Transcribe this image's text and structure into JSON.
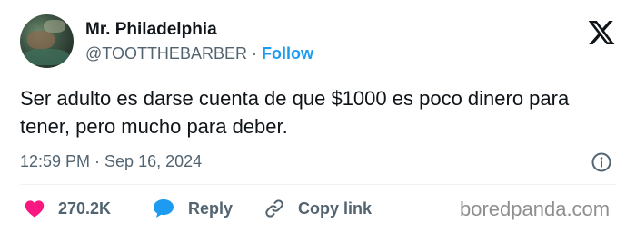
{
  "tweet": {
    "author_name": "Mr. Philadelphia",
    "handle": "@TOOTTHEBARBER",
    "separator": "·",
    "follow_label": "Follow",
    "text": "Ser adulto es darse cuenta de que $1000 es poco dinero para tener, pero mucho para deber.",
    "timestamp": "12:59 PM · Sep 16, 2024"
  },
  "actions": {
    "like_count": "270.2K",
    "reply_label": "Reply",
    "copy_link_label": "Copy link"
  },
  "watermark": "boredpanda.com",
  "icons": {
    "brand": "x-logo-icon",
    "info": "info-icon",
    "like": "heart-icon",
    "reply": "reply-bubble-icon",
    "copy": "link-icon"
  },
  "colors": {
    "like": "#f91880",
    "reply": "#1d9bf0",
    "follow": "#1d9bf0",
    "secondary_text": "#536471",
    "primary_text": "#0f1419"
  }
}
